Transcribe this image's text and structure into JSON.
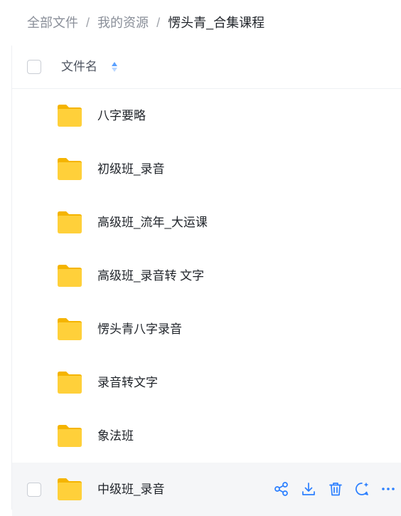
{
  "breadcrumb": {
    "items": [
      "全部文件",
      "我的资源"
    ],
    "separator": "/",
    "current": "愣头青_合集课程"
  },
  "list_header": {
    "column_title": "文件名",
    "sort_icon": "sort-updown-icon"
  },
  "files": [
    {
      "name": "八字要略",
      "icon": "folder-icon"
    },
    {
      "name": "初级班_录音",
      "icon": "folder-icon"
    },
    {
      "name": "高级班_流年_大运课",
      "icon": "folder-icon"
    },
    {
      "name": "高级班_录音转 文字",
      "icon": "folder-icon"
    },
    {
      "name": "愣头青八字录音",
      "icon": "folder-icon"
    },
    {
      "name": "录音转文字",
      "icon": "folder-icon"
    },
    {
      "name": "象法班",
      "icon": "folder-icon"
    },
    {
      "name": "中级班_录音",
      "icon": "folder-icon"
    }
  ],
  "row_actions": [
    "share-icon",
    "download-icon",
    "delete-icon",
    "ai-chat-icon",
    "more-icon"
  ],
  "colors": {
    "accent": "#2b7fff",
    "folder": "#ffc82c",
    "hover_row": "#f5f6f8"
  }
}
